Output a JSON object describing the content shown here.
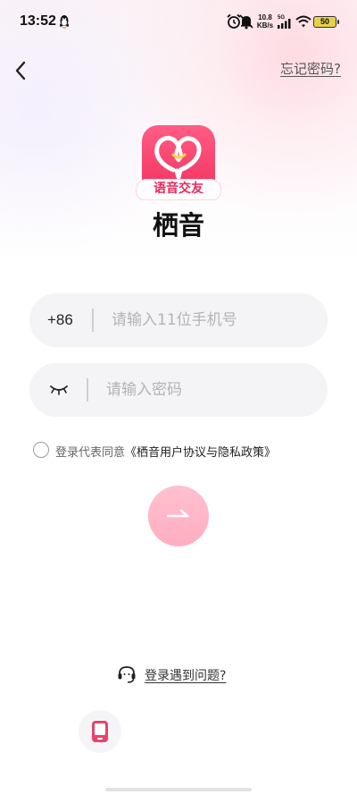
{
  "status_bar": {
    "time": "13:52",
    "net_speed_value": "10.8",
    "net_speed_unit": "KB/s",
    "network": "5G",
    "battery": "50"
  },
  "header": {
    "back_icon": "chevron-left-icon",
    "forgot_password": "忘记密码?"
  },
  "logo": {
    "tag": "语音交友",
    "app_name": "栖音",
    "brand_color": "#f0305d"
  },
  "form": {
    "country_code": "+86",
    "phone_placeholder": "请输入11位手机号",
    "phone_value": "",
    "password_placeholder": "请输入密码",
    "password_value": "",
    "password_toggle_icon": "eye-closed-icon"
  },
  "agreement": {
    "checked": false,
    "prefix": "登录代表同意",
    "link": "《栖音用户协议与隐私政策》"
  },
  "submit": {
    "icon": "arrow-right-icon",
    "color": "#ffb5c6"
  },
  "help": {
    "icon": "headset-icon",
    "label": "登录遇到问题?"
  },
  "alt_login": {
    "icon": "phone-login-icon",
    "color": "#e8446b"
  }
}
